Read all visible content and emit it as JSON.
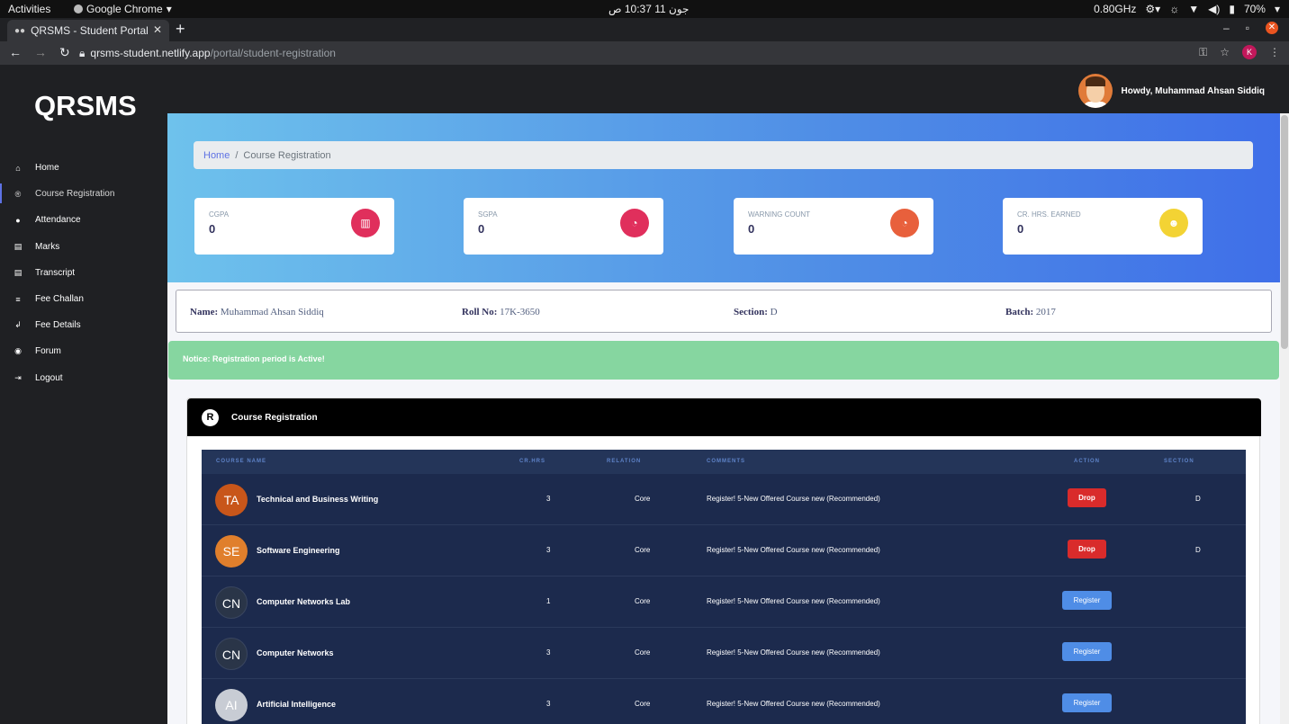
{
  "system_bar": {
    "activities": "Activities",
    "app_name": "Google Chrome",
    "clock": "جون 11  10:37 ص",
    "cpu": "0.80GHz",
    "battery": "70%"
  },
  "browser": {
    "tab_title": "QRSMS - Student Portal",
    "url_host": "qrsms-student.netlify.app",
    "url_path": "/portal/student-registration",
    "profile_initial": "K"
  },
  "sidebar": {
    "logo": "QRSMS",
    "items": [
      {
        "label": "Home",
        "icon": "home-icon",
        "glyph": "⌂"
      },
      {
        "label": "Course Registration",
        "icon": "registered-icon",
        "glyph": "®"
      },
      {
        "label": "Attendance",
        "icon": "user-icon",
        "glyph": "●"
      },
      {
        "label": "Marks",
        "icon": "document-icon",
        "glyph": "▤"
      },
      {
        "label": "Transcript",
        "icon": "document-icon",
        "glyph": "▤"
      },
      {
        "label": "Fee Challan",
        "icon": "money-icon",
        "glyph": "≡"
      },
      {
        "label": "Fee Details",
        "icon": "hand-money-icon",
        "glyph": "↲"
      },
      {
        "label": "Forum",
        "icon": "user-circle-icon",
        "glyph": "◉"
      },
      {
        "label": "Logout",
        "icon": "sign-out-icon",
        "glyph": "⇥"
      }
    ]
  },
  "header": {
    "greeting": "Howdy, Muhammad Ahsan Siddiq"
  },
  "breadcrumb": {
    "home": "Home",
    "separator": "/",
    "current": "Course Registration"
  },
  "stats": [
    {
      "label": "CGPA",
      "value": "0",
      "icon": "chart-bar-icon",
      "glyph": "▥",
      "color": "#e02f5c"
    },
    {
      "label": "SGPA",
      "value": "0",
      "icon": "chart-pie-icon",
      "glyph": "◔",
      "color": "#e02f5c"
    },
    {
      "label": "WARNING COUNT",
      "value": "0",
      "icon": "chart-pie-icon",
      "glyph": "◔",
      "color": "#e8603c"
    },
    {
      "label": "CR. HRS. EARNED",
      "value": "0",
      "icon": "users-icon",
      "glyph": "☻",
      "color": "#f3d334"
    }
  ],
  "student": {
    "name_label": "Name:",
    "name": "Muhammad Ahsan Siddiq",
    "roll_label": "Roll No:",
    "roll": "17K-3650",
    "section_label": "Section:",
    "section": "D",
    "batch_label": "Batch:",
    "batch": "2017"
  },
  "notice": "Notice: Registration period is Active!",
  "registration": {
    "title": "Course Registration",
    "columns": [
      "COURSE NAME",
      "CR.HRS",
      "RELATION",
      "COMMENTS",
      "ACTION",
      "SECTION"
    ],
    "rows": [
      {
        "initials": "TA",
        "avatar_color": "#c8561a",
        "name": "Technical and Business Writing",
        "crhrs": "3",
        "relation": "Core",
        "comments": "Register! 5-New Offered Course new (Recommended)",
        "action": "Drop",
        "section": "D"
      },
      {
        "initials": "SE",
        "avatar_color": "#e07f2c",
        "name": "Software Engineering",
        "crhrs": "3",
        "relation": "Core",
        "comments": "Register! 5-New Offered Course new (Recommended)",
        "action": "Drop",
        "section": "D"
      },
      {
        "initials": "CN",
        "avatar_color": "#2a3548",
        "name": "Computer Networks Lab",
        "crhrs": "1",
        "relation": "Core",
        "comments": "Register! 5-New Offered Course new (Recommended)",
        "action": "Register",
        "section": ""
      },
      {
        "initials": "CN",
        "avatar_color": "#2a3548",
        "name": "Computer Networks",
        "crhrs": "3",
        "relation": "Core",
        "comments": "Register! 5-New Offered Course new (Recommended)",
        "action": "Register",
        "section": ""
      },
      {
        "initials": "AI",
        "avatar_color": "#c8ccd4",
        "name": "Artificial Intelligence",
        "crhrs": "3",
        "relation": "Core",
        "comments": "Register! 5-New Offered Course new (Recommended)",
        "action": "Register",
        "section": ""
      }
    ]
  }
}
